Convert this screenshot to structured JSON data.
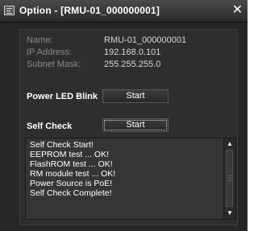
{
  "window": {
    "title": "Option - [RMU-01_000000001]",
    "close_glyph": "✕",
    "icon": "app-icon"
  },
  "info": {
    "name_label": "Name:",
    "name_value": "RMU-01_000000001",
    "ip_label": "IP Address:",
    "ip_value": "192.168.0.101",
    "mask_label": "Subnet Mask:",
    "mask_value": "255.255.255.0"
  },
  "power_led": {
    "label": "Power LED Blink",
    "button_label": "Start"
  },
  "self_check": {
    "label": "Self Check",
    "button_label": "Start"
  },
  "log": {
    "lines": [
      "Self Check Start!",
      "EEPROM test ... OK!",
      "FlashROM test ... OK!",
      "RM module test ... OK!",
      "Power Source is PoE!",
      "Self Check Complete!"
    ],
    "scroll_up_glyph": "▲",
    "scroll_down_glyph": "▼"
  },
  "colors": {
    "window_bg": "#262626",
    "panel_bg": "#2e2e2e",
    "label_gray": "#8a8a8a",
    "text_white": "#ffffff"
  }
}
